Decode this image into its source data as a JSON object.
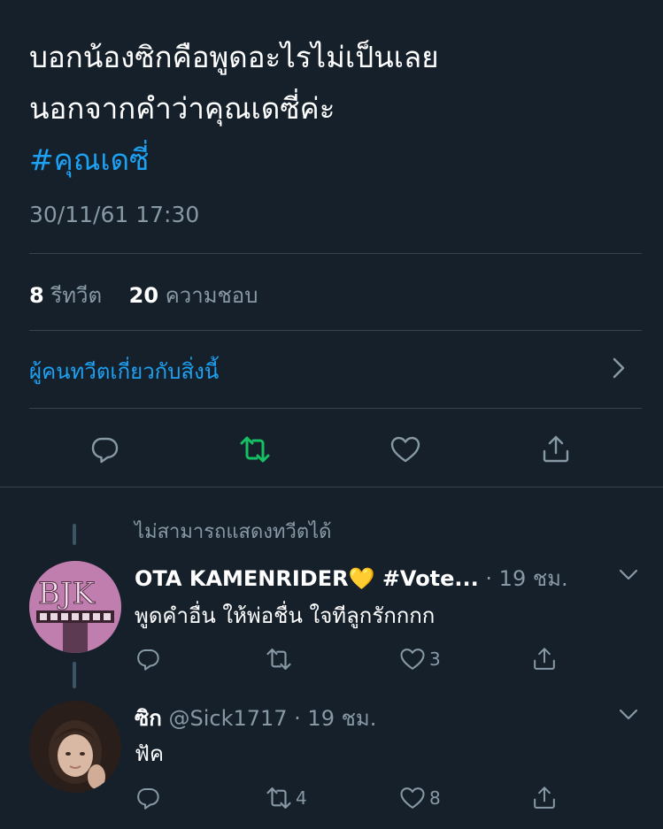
{
  "tweet": {
    "line1": "บอกน้องซิกคือพูดอะไรไม่เป็นเลย",
    "line2": "นอกจากคำว่าคุณเดซี่ค่ะ",
    "hashtag": "#คุณเดซี่",
    "timestamp": "30/11/61 17:30"
  },
  "stats": {
    "retweets_count": "8",
    "retweets_label": "รีทวีต",
    "likes_count": "20",
    "likes_label": "ความชอบ"
  },
  "related_link": "ผู้คนทวีตเกี่ยวกับสิ่งนี้",
  "actions": {
    "reply_icon": "reply-icon",
    "retweet_icon": "retweet-icon",
    "like_icon": "heart-icon",
    "share_icon": "share-icon",
    "retweet_color": "#17bf63"
  },
  "thread": {
    "unavailable": "ไม่สามารถแสดงทวีตได้"
  },
  "replies": [
    {
      "name": "OTA KAMENRIDER💛 #Vote...",
      "handle": "",
      "meta": " · 19 ชม.",
      "text": "พูดคำอื่น ให้พ่อชื่น ใจทีลูกรักกกก",
      "reply_count": "",
      "retweet_count": "",
      "like_count": "3"
    },
    {
      "name": "ซิก",
      "handle": "@Sick1717",
      "meta": " · 19 ชม.",
      "text": "ฟัค",
      "reply_count": "",
      "retweet_count": "4",
      "like_count": "8"
    }
  ],
  "colors": {
    "background": "#15202b",
    "accent": "#1da1f2",
    "muted": "#8899a6",
    "divider": "#38444d"
  }
}
